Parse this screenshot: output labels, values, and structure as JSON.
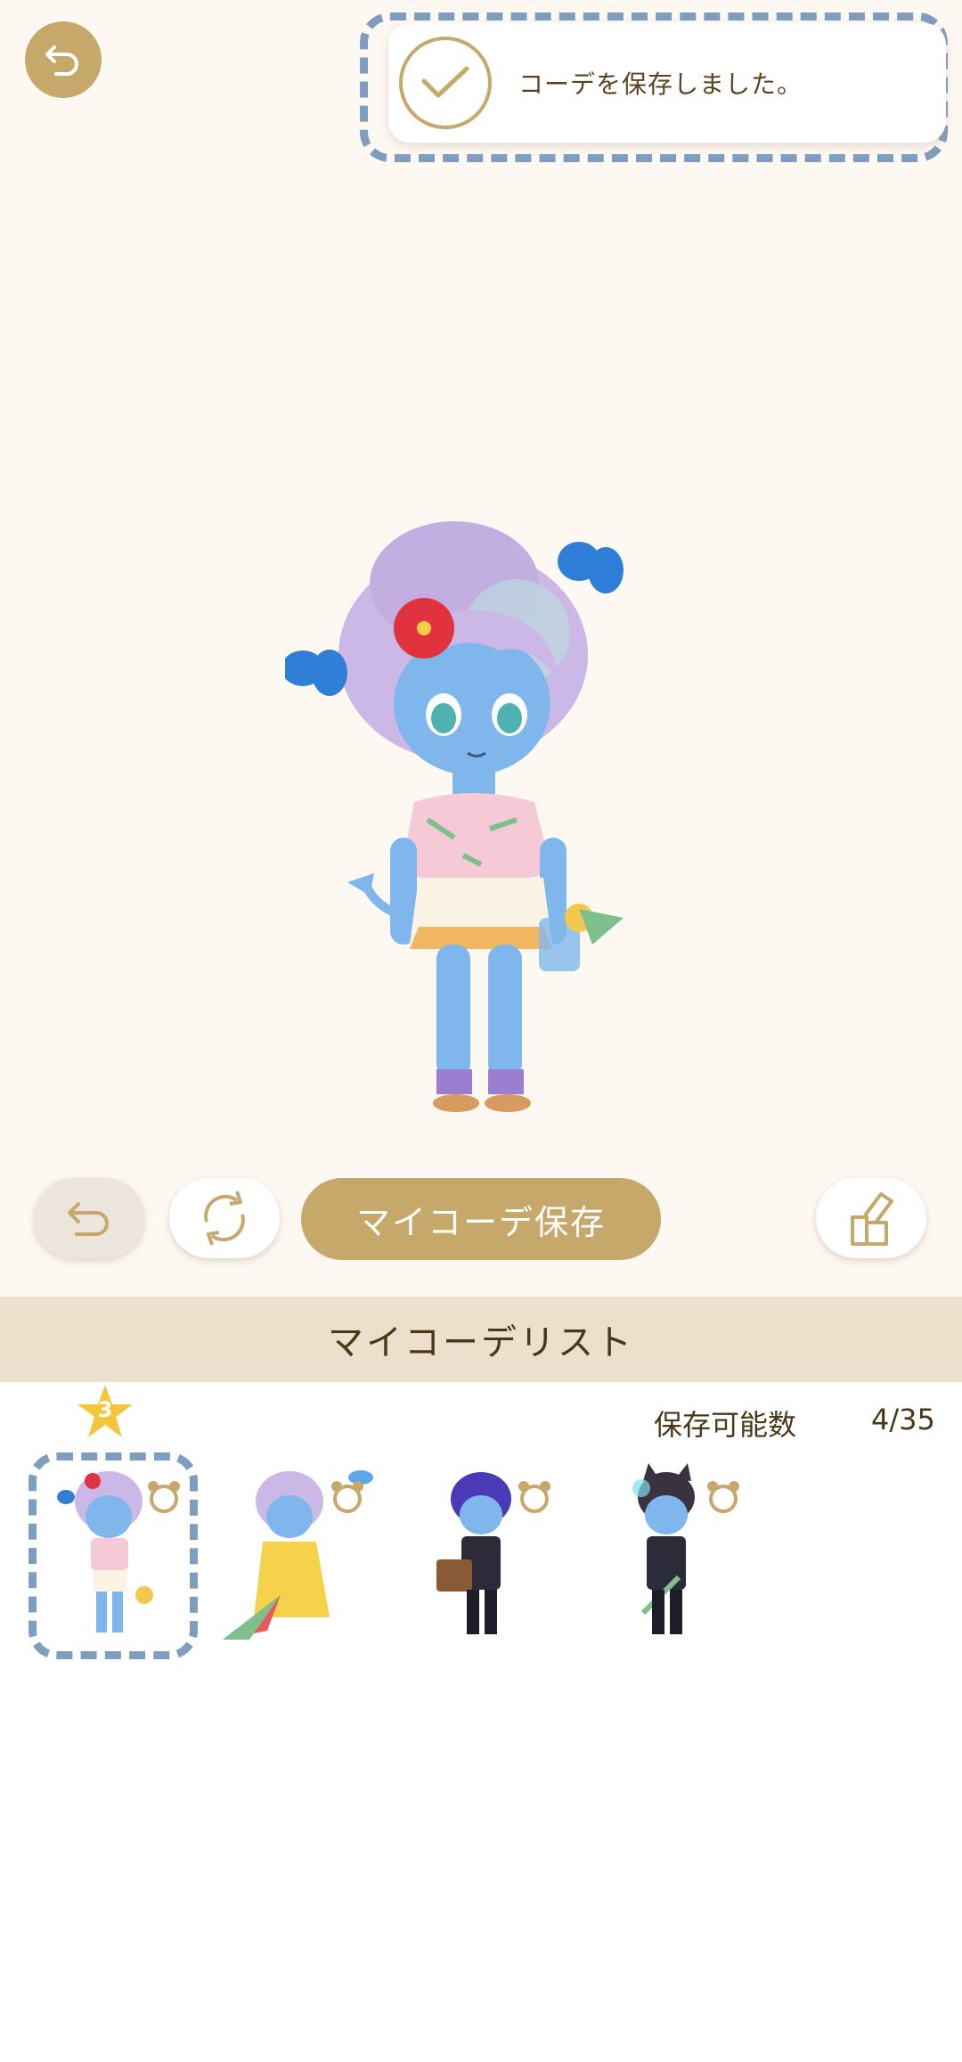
{
  "toast": {
    "message": "コーデを保存しました。"
  },
  "controls": {
    "save_label": "マイコーデ保存"
  },
  "list": {
    "title": "マイコーデリスト",
    "capacity_label": "保存可能数",
    "capacity_value": "4/35",
    "selected_badge": "3",
    "outfits": [
      {
        "theme": "tropical-shirt"
      },
      {
        "theme": "yellow-raincoat"
      },
      {
        "theme": "dark-suit-blue-hair"
      },
      {
        "theme": "dark-suit-black-hair"
      }
    ]
  },
  "colors": {
    "gold": "#c6a96a",
    "header_bg": "#ece0cc",
    "dashed_frame": "#7f9dc0",
    "background": "#fef8f2"
  },
  "icons": {
    "back": "back-arrow-icon",
    "undo": "undo-arrow-icon",
    "rotate": "rotate-icon",
    "share": "share-icon",
    "check": "check-icon",
    "star": "star-icon",
    "bear": "bear-icon"
  }
}
